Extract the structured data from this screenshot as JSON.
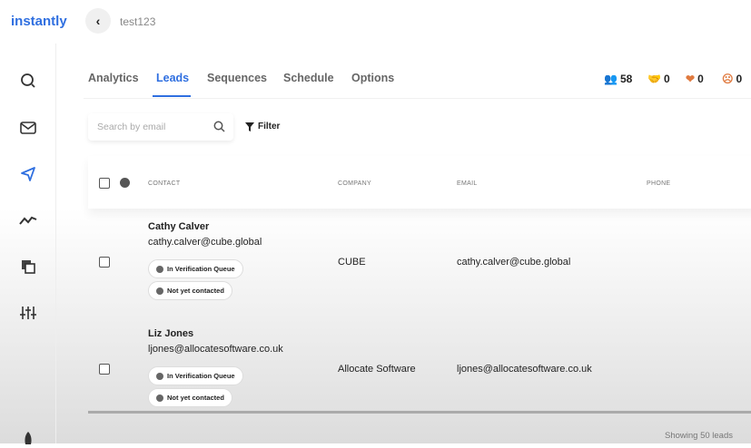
{
  "app": {
    "logo": "instantly",
    "campaign": "test123"
  },
  "tabs": [
    "Analytics",
    "Leads",
    "Sequences",
    "Schedule",
    "Options"
  ],
  "stats": [
    {
      "icon": "users-icon",
      "value": "58",
      "color": "#555555"
    },
    {
      "icon": "handshake-icon",
      "value": "0",
      "color": "#2f6fe0"
    },
    {
      "icon": "broken-heart-icon",
      "value": "0",
      "color": "#e07a3f"
    },
    {
      "icon": "sad-face-icon",
      "value": "0",
      "color": "#e07a3f"
    }
  ],
  "search": {
    "placeholder": "Search by email"
  },
  "filter_label": "Filter",
  "columns": [
    "CONTACT",
    "COMPANY",
    "EMAIL",
    "PHONE"
  ],
  "rows": [
    {
      "name": "Cathy Calver",
      "email": "cathy.calver@cube.global",
      "company": "CUBE",
      "email_col": "cathy.calver@cube.global",
      "badges": [
        "In Verification Queue",
        "Not yet contacted"
      ]
    },
    {
      "name": "Liz Jones",
      "email": "ljones@allocatesoftware.co.uk",
      "company": "Allocate Software",
      "email_col": "ljones@allocatesoftware.co.uk",
      "badges": [
        "In Verification Queue",
        "Not yet contacted"
      ]
    }
  ],
  "footer": "Showing 50 leads"
}
